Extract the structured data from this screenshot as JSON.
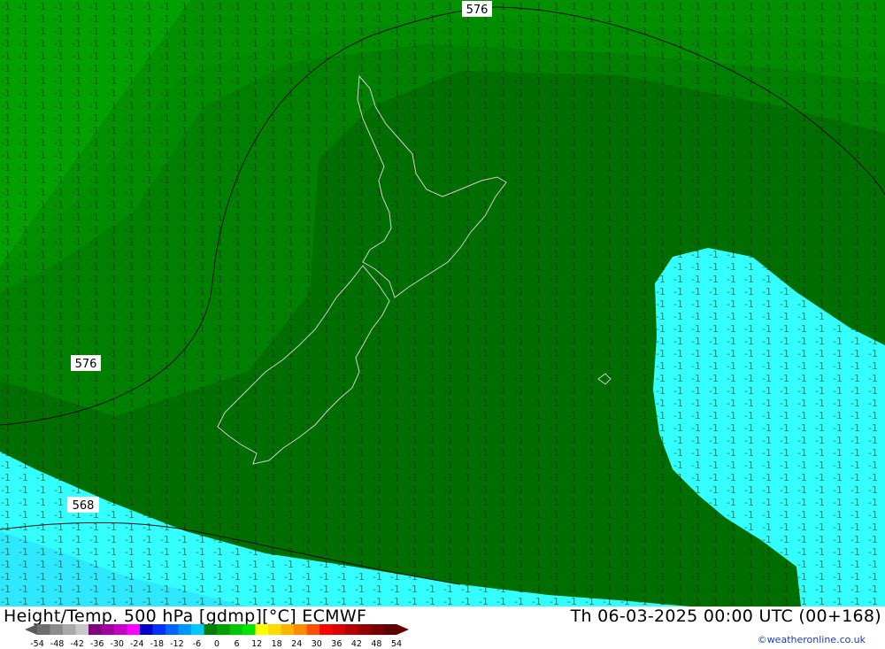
{
  "header": {
    "product_title": "Height/Temp. 500 hPa [gdmp][°C] ECMWF",
    "valid_time": "Th 06-03-2025 00:00 UTC (00+168)",
    "credit": "©weatheronline.co.uk"
  },
  "map": {
    "region": "New Zealand",
    "height_contour_labels": [
      "576",
      "576",
      "568"
    ],
    "temperature_zones": [
      {
        "label": "-8",
        "color": "#00a000"
      },
      {
        "label": "-9",
        "color": "#009000"
      },
      {
        "label": "-10..-12",
        "color": "#008000"
      },
      {
        "label": "-13..-14",
        "color": "#006e00"
      },
      {
        "label": "-15..-19",
        "color": "#33ffff"
      }
    ],
    "coastline_color": "#d0d0d0"
  },
  "legend": {
    "tick_labels": [
      "-54",
      "-48",
      "-42",
      "-36",
      "-30",
      "-24",
      "-18",
      "-12",
      "-6",
      "0",
      "6",
      "12",
      "18",
      "24",
      "30",
      "36",
      "42",
      "48",
      "54"
    ],
    "colors": [
      "#6e6e6e",
      "#8c8c8c",
      "#aaaaaa",
      "#c8c8c8",
      "#800080",
      "#a000a0",
      "#c800c8",
      "#ff00ff",
      "#0000c8",
      "#0032ff",
      "#0064ff",
      "#0096ff",
      "#00c8ff",
      "#008000",
      "#00a000",
      "#00c800",
      "#00e600",
      "#ffff00",
      "#ffdc00",
      "#ffb400",
      "#ff8c00",
      "#ff5000",
      "#ff0000",
      "#dc0000",
      "#b40000",
      "#960000",
      "#780000",
      "#600000"
    ]
  }
}
